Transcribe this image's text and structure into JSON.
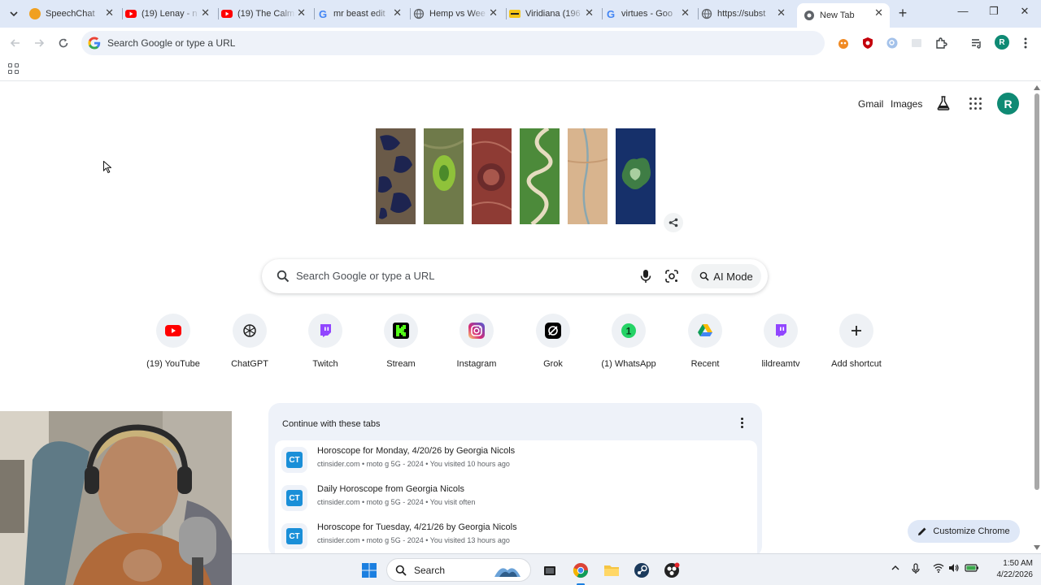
{
  "browser": {
    "tabs": [
      {
        "title": "SpeechChat",
        "icon": "speechchat-icon",
        "color": "#f0a020"
      },
      {
        "title": "(19) Lenay - n",
        "icon": "youtube-icon",
        "color": "#ff0000"
      },
      {
        "title": "(19) The Calm",
        "icon": "youtube-icon",
        "color": "#ff0000"
      },
      {
        "title": "mr beast edit",
        "icon": "google-icon",
        "color": "#4285f4"
      },
      {
        "title": "Hemp vs Wee",
        "icon": "globe-icon",
        "color": "#5f6368"
      },
      {
        "title": "Viridiana (196",
        "icon": "imdb-icon",
        "color": "#f5c518"
      },
      {
        "title": "virtues - Goo",
        "icon": "google-icon",
        "color": "#4285f4"
      },
      {
        "title": "https://subst",
        "icon": "globe-icon",
        "color": "#5f6368"
      },
      {
        "title": "New Tab",
        "icon": "chrome-icon",
        "color": "#5f6368",
        "active": true
      }
    ],
    "omnibox_placeholder": "Search Google or type a URL",
    "profile_initial": "R"
  },
  "ntp": {
    "links": {
      "gmail": "Gmail",
      "images": "Images"
    },
    "profile_initial": "R",
    "search_placeholder": "Search Google or type a URL",
    "ai_mode_label": "AI Mode",
    "shortcuts": [
      {
        "label": "(19) YouTube",
        "icon": "youtube-icon"
      },
      {
        "label": "ChatGPT",
        "icon": "chatgpt-icon"
      },
      {
        "label": "Twitch",
        "icon": "twitch-icon"
      },
      {
        "label": "Stream",
        "icon": "kick-icon"
      },
      {
        "label": "Instagram",
        "icon": "instagram-icon"
      },
      {
        "label": "Grok",
        "icon": "grok-icon"
      },
      {
        "label": "(1) WhatsApp",
        "icon": "whatsapp-icon"
      },
      {
        "label": "Recent",
        "icon": "google-drive-icon"
      },
      {
        "label": "lildreamtv",
        "icon": "twitch-icon"
      },
      {
        "label": "Add shortcut",
        "icon": "plus-icon"
      }
    ],
    "continue": {
      "heading": "Continue with these tabs",
      "items": [
        {
          "title": "Horoscope for Monday, 4/20/26 by Georgia Nicols",
          "meta": "ctinsider.com • moto g 5G - 2024 • You visited 10 hours ago",
          "icon_text": "CT"
        },
        {
          "title": "Daily Horoscope from Georgia Nicols",
          "meta": "ctinsider.com • moto g 5G - 2024 • You visit often",
          "icon_text": "CT"
        },
        {
          "title": "Horoscope for Tuesday, 4/21/26 by Georgia Nicols",
          "meta": "ctinsider.com • moto g 5G - 2024 • You visited 13 hours ago",
          "icon_text": "CT"
        }
      ]
    },
    "customize_label": "Customize Chrome"
  },
  "taskbar": {
    "search_label": "Search",
    "time": "1:50 AM",
    "date": "4/22/2026"
  },
  "colors": {
    "accent": "#0f8a74",
    "tabstrip": "#dfe8f7",
    "youtube": "#ff0000",
    "twitch": "#9146ff",
    "kick": "#53fc18",
    "whatsapp": "#25d366"
  }
}
